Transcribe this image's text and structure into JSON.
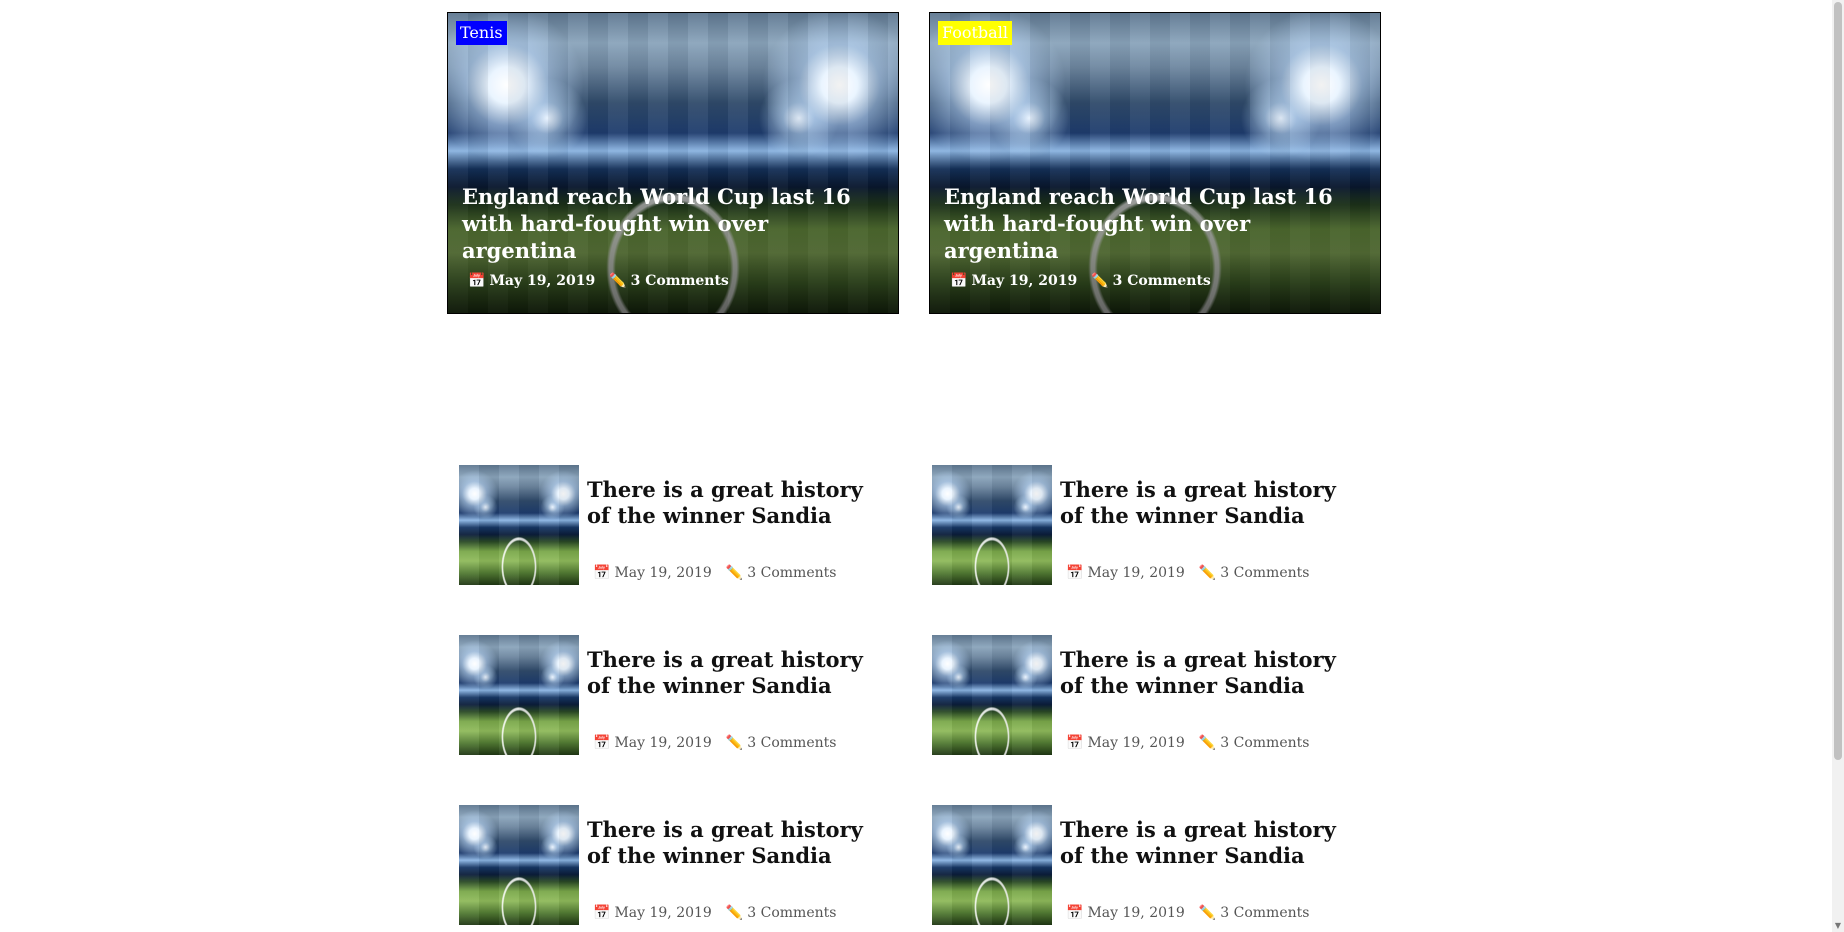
{
  "featured": [
    {
      "category": "Tenis",
      "category_color": "#0000ff",
      "title": "England reach World Cup last 16 with hard-fought win over argentina",
      "date": "May 19, 2019",
      "comments": "3 Comments"
    },
    {
      "category": "Football",
      "category_color": "#ffff00",
      "title": "England reach World Cup last 16 with hard-fought win over argentina",
      "date": "May 19, 2019",
      "comments": "3 Comments"
    }
  ],
  "posts": [
    {
      "title": "There is a great history of the winner Sandia",
      "date": "May 19, 2019",
      "comments": "3 Comments"
    },
    {
      "title": "There is a great history of the winner Sandia",
      "date": "May 19, 2019",
      "comments": "3 Comments"
    },
    {
      "title": "There is a great history of the winner Sandia",
      "date": "May 19, 2019",
      "comments": "3 Comments"
    },
    {
      "title": "There is a great history of the winner Sandia",
      "date": "May 19, 2019",
      "comments": "3 Comments"
    },
    {
      "title": "There is a great history of the winner Sandia",
      "date": "May 19, 2019",
      "comments": "3 Comments"
    },
    {
      "title": "There is a great history of the winner Sandia",
      "date": "May 19, 2019",
      "comments": "3 Comments"
    }
  ],
  "icons": {
    "date": "calendar-icon",
    "comments": "pencil-icon"
  }
}
